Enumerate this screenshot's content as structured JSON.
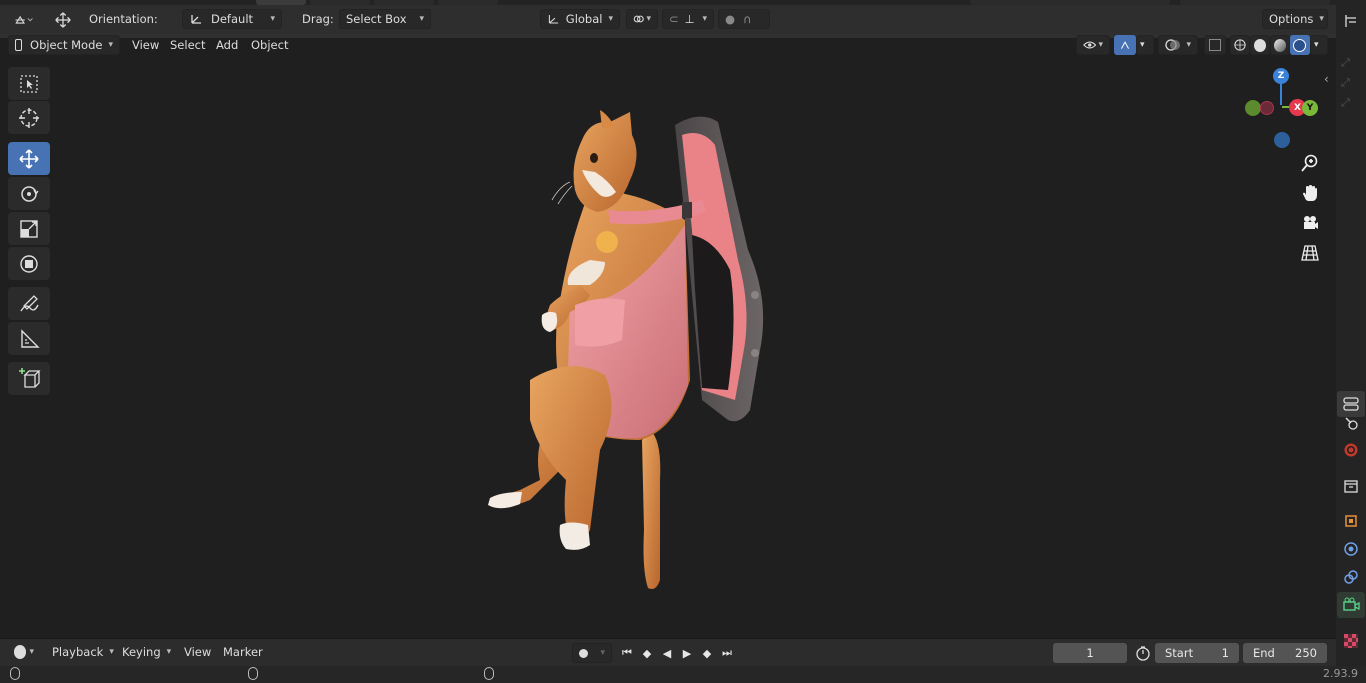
{
  "header": {
    "orientation_label": "Orientation:",
    "orientation_value": "Default",
    "drag_label": "Drag:",
    "drag_value": "Select Box",
    "transform_orientation": "Global",
    "options_label": "Options"
  },
  "viewport_header": {
    "mode": "Object Mode",
    "menu": [
      "View",
      "Select",
      "Add",
      "Object"
    ]
  },
  "tools": [
    "select-box",
    "cursor",
    "move",
    "rotate",
    "scale",
    "transform",
    "annotate",
    "measure",
    "add-cube"
  ],
  "active_tool": "move",
  "gizmo": {
    "z": "Z",
    "x": "X",
    "y": "Y"
  },
  "timeline": {
    "menus": [
      "Playback",
      "Keying",
      "View",
      "Marker"
    ],
    "current_frame": "1",
    "start_label": "Start",
    "start_value": "1",
    "end_label": "End",
    "end_value": "250"
  },
  "status": {
    "version": "2.93.9"
  },
  "colors": {
    "accent": "#4772b3",
    "cat_fur": "#d98a47",
    "harness": "#e8898f",
    "seat_frame": "#5a5455"
  }
}
